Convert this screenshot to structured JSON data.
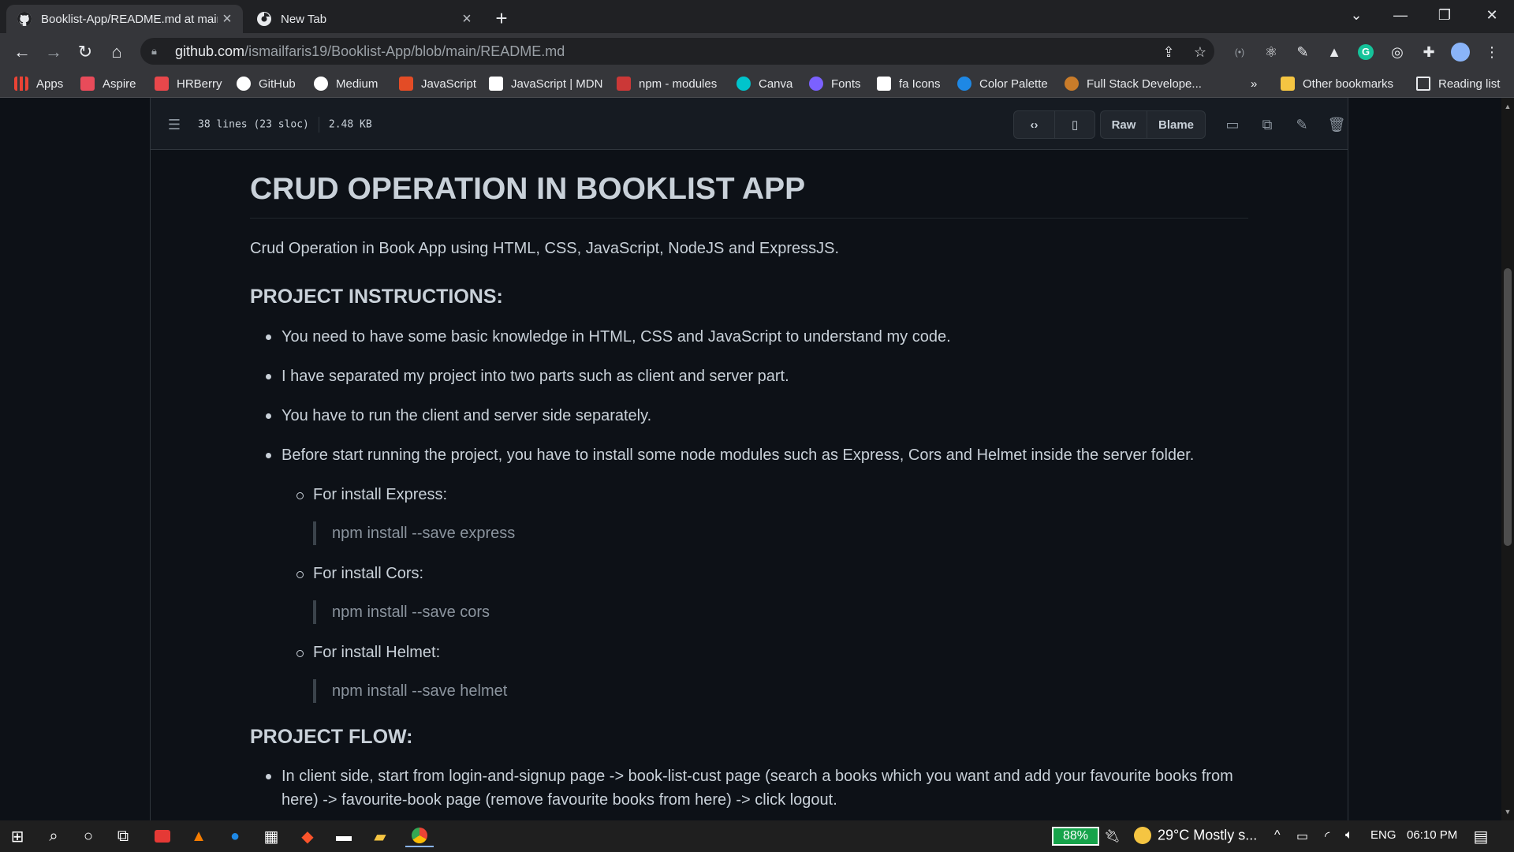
{
  "browser": {
    "tabs": [
      {
        "title": "Booklist-App/README.md at main",
        "icon": "github-icon"
      },
      {
        "title": "New Tab",
        "icon": "chrome-icon"
      }
    ],
    "url_host": "github.com",
    "url_path": "/ismailfaris19/Booklist-App/blob/main/README.md"
  },
  "bookmarks": [
    {
      "label": "Apps",
      "color": "#4285f4"
    },
    {
      "label": "Aspire",
      "color": "#e84b5a"
    },
    {
      "label": "HRBerry",
      "color": "#e8474b"
    },
    {
      "label": "GitHub",
      "color": "#ffffff"
    },
    {
      "label": "Medium",
      "color": "#ffffff"
    },
    {
      "label": "JavaScript",
      "color": "#e34c26"
    },
    {
      "label": "JavaScript | MDN",
      "color": "#ffffff"
    },
    {
      "label": "npm - modules",
      "color": "#cb3837"
    },
    {
      "label": "Canva",
      "color": "#00c4cc"
    },
    {
      "label": "Fonts",
      "color": "#7b61ff"
    },
    {
      "label": "fa Icons",
      "color": "#ffffff"
    },
    {
      "label": "Color Palette",
      "color": "#1e88e5"
    },
    {
      "label": "Full Stack Develope...",
      "color": "#c97c2a"
    }
  ],
  "bookmarks_right": {
    "more": "»",
    "other": "Other bookmarks",
    "reading": "Reading list"
  },
  "file": {
    "lines": "38 lines (23 sloc)",
    "size": "2.48 KB",
    "raw": "Raw",
    "blame": "Blame"
  },
  "readme": {
    "title": "CRUD OPERATION IN BOOKLIST APP",
    "intro": "Crud Operation in Book App using HTML, CSS, JavaScript, NodeJS and ExpressJS.",
    "h_instructions": "PROJECT INSTRUCTIONS:",
    "instructions": [
      "You need to have some basic knowledge in HTML, CSS and JavaScript to understand my code.",
      "I have separated my project into two parts such as client and server part.",
      "You have to run the client and server side separately.",
      "Before start running the project, you have to install some node modules such as Express, Cors and Helmet inside the server folder."
    ],
    "installs": [
      {
        "label": "For install Express:",
        "cmd": "npm install --save express"
      },
      {
        "label": "For install Cors:",
        "cmd": "npm install --save cors"
      },
      {
        "label": "For install Helmet:",
        "cmd": "npm install --save helmet"
      }
    ],
    "h_flow": "PROJECT FLOW:",
    "flow_line1": "In client side, start from login-and-signup page -> book-list-cust page (search a books which you want and add your favourite books from",
    "flow_line2": "here) -> favourite-book page (remove favourite books from here) -> click logout."
  },
  "taskbar": {
    "battery": "88%",
    "weather": "29°C  Mostly s...",
    "lang": "ENG",
    "time": "06:10 PM"
  }
}
